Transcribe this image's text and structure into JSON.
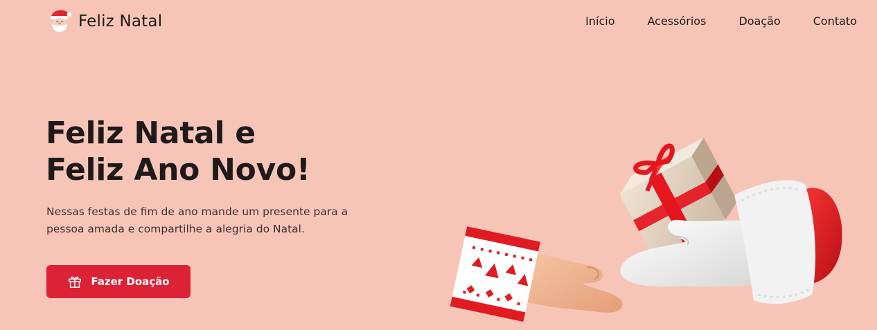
{
  "header": {
    "brand": "Feliz Natal",
    "logo_icon": "santa-claus-icon",
    "nav": [
      {
        "label": "Início"
      },
      {
        "label": "Acessórios"
      },
      {
        "label": "Doação"
      },
      {
        "label": "Contato"
      }
    ]
  },
  "hero": {
    "title_line1": "Feliz Natal e",
    "title_line2": "Feliz Ano Novo!",
    "description": "Nessas festas de fim de ano mande um presente para a pessoa amada e compartilhe a alegria do Natal.",
    "cta_label": "Fazer Doação",
    "cta_icon": "gift-icon",
    "illustration": "santa-hand-giving-gift-illustration"
  },
  "colors": {
    "background": "#f7c5b8",
    "accent": "#db2236",
    "text": "#1f1a19"
  }
}
